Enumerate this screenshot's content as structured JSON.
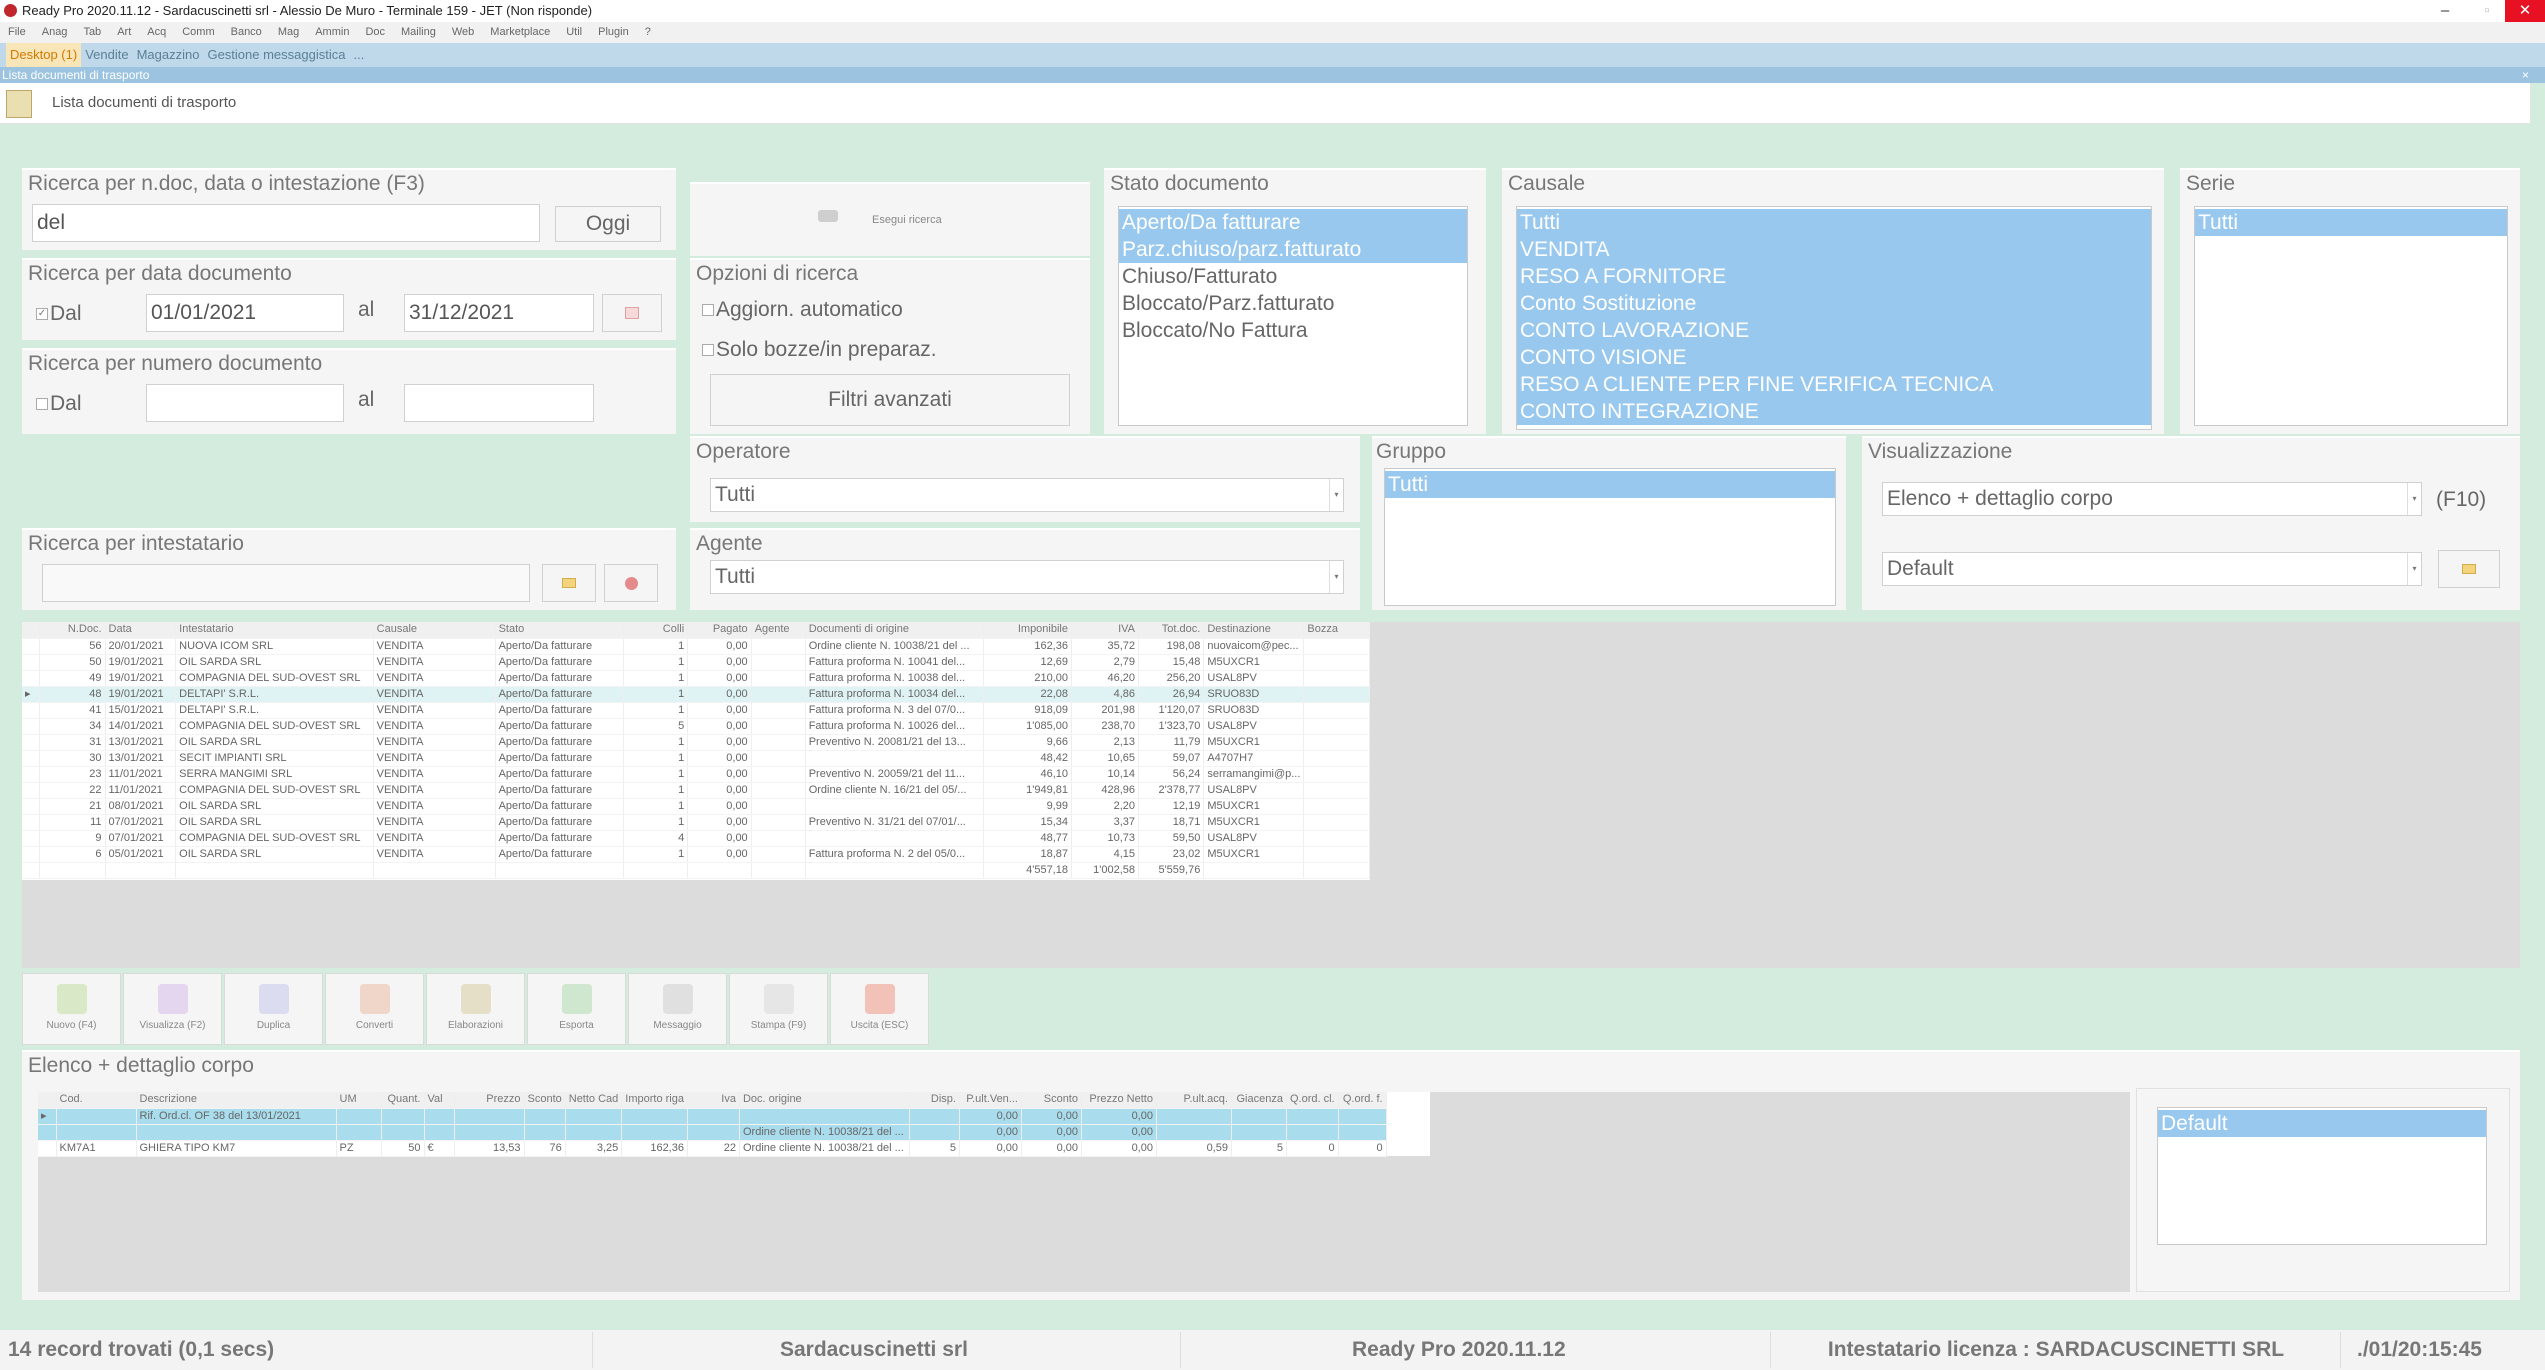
{
  "window": {
    "title": "Ready Pro 2020.11.12 - Sardacuscinetti srl - Alessio  De Muro - Terminale 159 - JET (Non risponde)",
    "minimize": "–",
    "maximize": "▫",
    "close": "✕"
  },
  "menu": [
    "File",
    "Anag",
    "Tab",
    "Art",
    "Acq",
    "Comm",
    "Banco",
    "Mag",
    "Ammin",
    "Doc",
    "Mailing",
    "Web",
    "Marketplace",
    "Util",
    "Plugin",
    "?"
  ],
  "tabs": [
    "Desktop (1)",
    "Vendite",
    "Magazzino",
    "Gestione messaggistica",
    "..."
  ],
  "doc_title": "Lista documenti di trasporto",
  "doc_close": "×",
  "page_label": "Lista documenti di trasporto",
  "search": {
    "title": "Ricerca per n.doc, data o intestazione (F3)",
    "value": "del",
    "today_btn": "Oggi"
  },
  "search_date": {
    "title": "Ricerca per data documento",
    "from_label": "Dal",
    "from": "01/01/2021",
    "to_label": "al",
    "to": "31/12/2021"
  },
  "search_num": {
    "title": "Ricerca per numero documento",
    "from_label": "Dal",
    "to_label": "al"
  },
  "run_search": "Esegui ricerca",
  "options": {
    "title": "Opzioni di ricerca",
    "auto": "Aggiorn. automatico",
    "drafts": "Solo bozze/in preparaz.",
    "adv_filters": "Filtri avanzati"
  },
  "stato": {
    "title": "Stato documento",
    "items": [
      "Aperto/Da fatturare",
      "Parz.chiuso/parz.fatturato",
      "Chiuso/Fatturato",
      "Bloccato/Parz.fatturato",
      "Bloccato/No Fattura"
    ],
    "selected": [
      0,
      1
    ]
  },
  "causale": {
    "title": "Causale",
    "items": [
      "Tutti",
      "VENDITA",
      "RESO A FORNITORE",
      "Conto Sostituzione",
      "CONTO LAVORAZIONE",
      "CONTO VISIONE",
      "RESO A CLIENTE PER FINE VERIFICA TECNICA",
      "CONTO INTEGRAZIONE"
    ]
  },
  "serie": {
    "title": "Serie",
    "items": [
      "Tutti"
    ]
  },
  "operatore": {
    "title": "Operatore",
    "value": "Tutti"
  },
  "agente": {
    "title": "Agente",
    "value": "Tutti"
  },
  "gruppo": {
    "title": "Gruppo",
    "items": [
      "Tutti"
    ]
  },
  "visual": {
    "title": "Visualizzazione",
    "value": "Elenco + dettaglio corpo",
    "hotkey": "(F10)",
    "layout": "Default"
  },
  "intestatario": {
    "title": "Ricerca per intestatario"
  },
  "docs": {
    "headers": [
      "N.Doc.",
      "Data",
      "Intestatario",
      "Causale",
      "Stato",
      "Colli",
      "Pagato",
      "Agente",
      "Documenti di origine",
      "Imponibile",
      "IVA",
      "Tot.doc.",
      "Destinazione",
      "Bozza"
    ],
    "rows": [
      [
        "56",
        "20/01/2021",
        "NUOVA ICOM SRL",
        "VENDITA",
        "Aperto/Da fatturare",
        "1",
        "0,00",
        "",
        "Ordine cliente N. 10038/21 del ...",
        "162,36",
        "35,72",
        "198,08",
        "nuovaicom@pec...",
        ""
      ],
      [
        "50",
        "19/01/2021",
        "OIL SARDA SRL",
        "VENDITA",
        "Aperto/Da fatturare",
        "1",
        "0,00",
        "",
        "Fattura proforma N. 10041 del...",
        "12,69",
        "2,79",
        "15,48",
        "M5UXCR1",
        ""
      ],
      [
        "49",
        "19/01/2021",
        "COMPAGNIA DEL SUD-OVEST SRL",
        "VENDITA",
        "Aperto/Da fatturare",
        "1",
        "0,00",
        "",
        "Fattura proforma N. 10038 del...",
        "210,00",
        "46,20",
        "256,20",
        "USAL8PV",
        ""
      ],
      [
        "48",
        "19/01/2021",
        "DELTAPI' S.R.L.",
        "VENDITA",
        "Aperto/Da fatturare",
        "1",
        "0,00",
        "",
        "Fattura proforma N. 10034 del...",
        "22,08",
        "4,86",
        "26,94",
        "SRUO83D",
        ""
      ],
      [
        "41",
        "15/01/2021",
        "DELTAPI' S.R.L.",
        "VENDITA",
        "Aperto/Da fatturare",
        "1",
        "0,00",
        "",
        "Fattura proforma N. 3 del 07/0...",
        "918,09",
        "201,98",
        "1'120,07",
        "SRUO83D",
        ""
      ],
      [
        "34",
        "14/01/2021",
        "COMPAGNIA DEL SUD-OVEST SRL",
        "VENDITA",
        "Aperto/Da fatturare",
        "5",
        "0,00",
        "",
        "Fattura proforma N. 10026 del...",
        "1'085,00",
        "238,70",
        "1'323,70",
        "USAL8PV",
        ""
      ],
      [
        "31",
        "13/01/2021",
        "OIL SARDA SRL",
        "VENDITA",
        "Aperto/Da fatturare",
        "1",
        "0,00",
        "",
        "Preventivo N. 20081/21 del 13...",
        "9,66",
        "2,13",
        "11,79",
        "M5UXCR1",
        ""
      ],
      [
        "30",
        "13/01/2021",
        "SECIT IMPIANTI SRL",
        "VENDITA",
        "Aperto/Da fatturare",
        "1",
        "0,00",
        "",
        "",
        "48,42",
        "10,65",
        "59,07",
        "A4707H7",
        ""
      ],
      [
        "23",
        "11/01/2021",
        "SERRA MANGIMI SRL",
        "VENDITA",
        "Aperto/Da fatturare",
        "1",
        "0,00",
        "",
        "Preventivo N. 20059/21 del 11...",
        "46,10",
        "10,14",
        "56,24",
        "serramangimi@p...",
        ""
      ],
      [
        "22",
        "11/01/2021",
        "COMPAGNIA DEL SUD-OVEST SRL",
        "VENDITA",
        "Aperto/Da fatturare",
        "1",
        "0,00",
        "",
        "Ordine cliente N. 16/21 del 05/...",
        "1'949,81",
        "428,96",
        "2'378,77",
        "USAL8PV",
        ""
      ],
      [
        "21",
        "08/01/2021",
        "OIL SARDA SRL",
        "VENDITA",
        "Aperto/Da fatturare",
        "1",
        "0,00",
        "",
        "",
        "9,99",
        "2,20",
        "12,19",
        "M5UXCR1",
        ""
      ],
      [
        "11",
        "07/01/2021",
        "OIL SARDA SRL",
        "VENDITA",
        "Aperto/Da fatturare",
        "1",
        "0,00",
        "",
        "Preventivo N. 31/21 del 07/01/...",
        "15,34",
        "3,37",
        "18,71",
        "M5UXCR1",
        ""
      ],
      [
        "9",
        "07/01/2021",
        "COMPAGNIA DEL SUD-OVEST SRL",
        "VENDITA",
        "Aperto/Da fatturare",
        "4",
        "0,00",
        "",
        "",
        "48,77",
        "10,73",
        "59,50",
        "USAL8PV",
        ""
      ],
      [
        "6",
        "05/01/2021",
        "OIL SARDA SRL",
        "VENDITA",
        "Aperto/Da fatturare",
        "1",
        "0,00",
        "",
        "Fattura proforma N. 2 del 05/0...",
        "18,87",
        "4,15",
        "23,02",
        "M5UXCR1",
        ""
      ]
    ],
    "totals": {
      "imponibile": "4'557,18",
      "iva": "1'002,58",
      "totale": "5'559,76"
    }
  },
  "toolbar": [
    "Nuovo (F4)",
    "Visualizza (F2)",
    "Duplica",
    "Converti",
    "Elaborazioni",
    "Esporta",
    "Messaggio",
    "Stampa (F9)",
    "Uscita (ESC)"
  ],
  "detail": {
    "title": "Elenco + dettaglio corpo",
    "headers": [
      "Cod.",
      "Descrizione",
      "UM",
      "Quant.",
      "Val",
      "Prezzo",
      "Sconto",
      "Netto Cad",
      "Importo riga",
      "Iva",
      "Doc. origine",
      "Disp.",
      "P.ult.Ven...",
      "Sconto",
      "Prezzo Netto",
      "P.ult.acq.",
      "Giacenza",
      "Q.ord. cl.",
      "Q.ord. f."
    ],
    "rows": [
      [
        "",
        "Rif. Ord.cl. OF 38 del 13/01/2021",
        "",
        "",
        "",
        "",
        "",
        "",
        "",
        "",
        "",
        "",
        "0,00",
        "0,00",
        "0,00",
        "",
        "",
        "",
        ""
      ],
      [
        "",
        "",
        "",
        "",
        "",
        "",
        "",
        "",
        "",
        "",
        "Ordine cliente N. 10038/21 del ...",
        "",
        "0,00",
        "0,00",
        "0,00",
        "",
        "",
        "",
        ""
      ],
      [
        "KM7A1",
        "GHIERA TIPO  KM7",
        "PZ",
        "50",
        "€",
        "13,53",
        "76",
        "3,25",
        "162,36",
        "22",
        "Ordine cliente N. 10038/21 del ...",
        "5",
        "0,00",
        "0,00",
        "0,00",
        "0,59",
        "5",
        "0",
        "0"
      ]
    ],
    "layout_items": [
      "Default"
    ]
  },
  "status": {
    "records": "14 record trovati (0,1 secs)",
    "company": "Sardacuscinetti srl",
    "version": "Ready Pro 2020.11.12",
    "licence": "Intestatario licenza : SARDACUSCINETTI SRL",
    "datetime": "./01/20:15:45"
  }
}
